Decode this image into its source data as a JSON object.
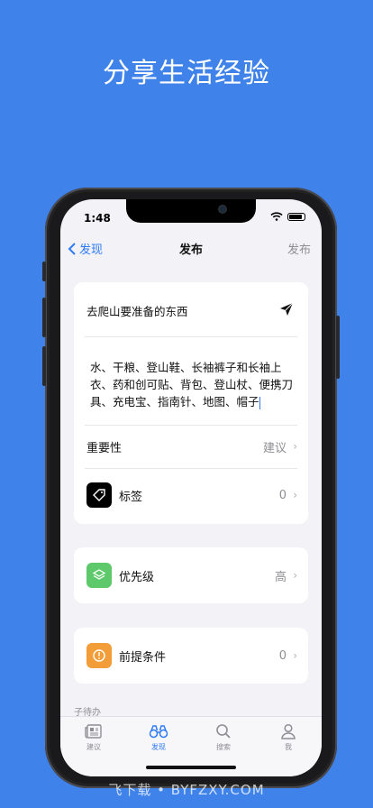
{
  "headline": "分享生活经验",
  "status": {
    "time": "1:48"
  },
  "nav": {
    "back_label": "发现",
    "title": "发布",
    "right_label": "发布"
  },
  "post": {
    "title": "去爬山要准备的东西",
    "body": "水、干粮、登山鞋、长袖裤子和长袖上衣、药和创可贴、背包、登山杖、便携刀具、充电宝、指南针、地图、帽子"
  },
  "rows": {
    "importance": {
      "label": "重要性",
      "value": "建议"
    },
    "tags": {
      "label": "标签",
      "value": "0"
    },
    "priority": {
      "label": "优先级",
      "value": "高"
    },
    "prerequisite": {
      "label": "前提条件",
      "value": "0"
    }
  },
  "section": {
    "subtasks_label": "子待办"
  },
  "tabs": [
    {
      "label": "建议",
      "icon": "newspaper-icon"
    },
    {
      "label": "发现",
      "icon": "binoculars-icon"
    },
    {
      "label": "搜索",
      "icon": "search-icon"
    },
    {
      "label": "我",
      "icon": "person-icon"
    }
  ],
  "watermark": "飞下载 • BYFZXY.COM",
  "colors": {
    "background": "#3f82ea",
    "accent": "#2f7bf6",
    "tag_icon": "#000000",
    "priority_icon": "#5ec96a",
    "prereq_icon": "#f29d38"
  }
}
